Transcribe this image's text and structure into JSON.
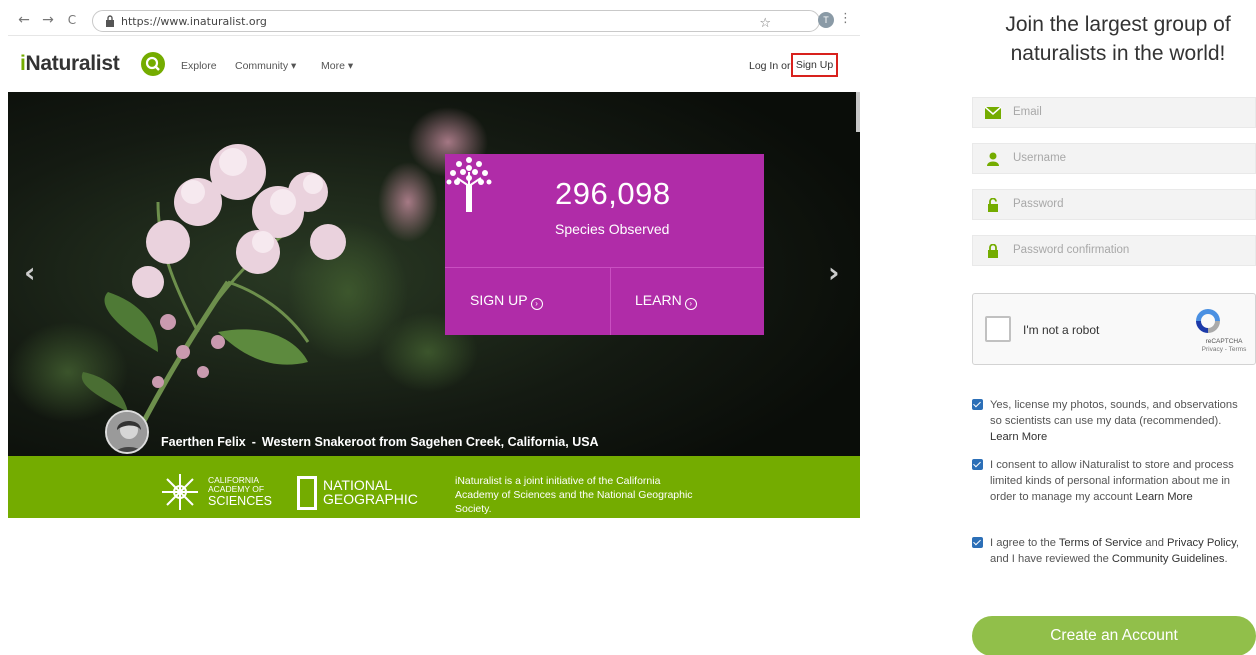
{
  "browser": {
    "url": "https://www.inaturalist.org",
    "back_glyph": "←",
    "forward_glyph": "→",
    "reload_glyph": "C",
    "star_glyph": "☆",
    "profile_initial": "T",
    "menu_glyph": "⋮"
  },
  "site": {
    "logo_i": "i",
    "logo_rest": "Naturalist",
    "nav": {
      "explore": "Explore",
      "community": "Community ▾",
      "more": "More ▾",
      "login": "Log In or",
      "signup": "Sign Up"
    },
    "hero": {
      "stat_number": "296,098",
      "stat_label": "Species Observed",
      "card_signup": "SIGN UP",
      "card_learn": "LEARN",
      "prev": "‹",
      "next": "›",
      "photo_credit_name": "Faerthen Felix",
      "photo_credit_sep": "-",
      "photo_credit_desc": "Western Snakeroot from Sagehen Creek, California, USA"
    },
    "footer": {
      "cas_line1": "CALIFORNIA",
      "cas_line2": "ACADEMY OF",
      "cas_line3": "SCIENCES",
      "natgeo_line1": "NATIONAL",
      "natgeo_line2": "GEOGRAPHIC",
      "initiative": "iNaturalist is a joint initiative of the California Academy of Sciences and the National Geographic Society."
    }
  },
  "form": {
    "title": "Join the largest group of naturalists in the world!",
    "email_placeholder": "Email",
    "username_placeholder": "Username",
    "password_placeholder": "Password",
    "password_confirm_placeholder": "Password confirmation",
    "recaptcha_label": "I'm not a robot",
    "recaptcha_brand": "reCAPTCHA",
    "recaptcha_terms": "Privacy - Terms",
    "consent_license_a": "Yes, license my photos, sounds, and observations so scientists can use my data (recommended).",
    "consent_license_learn": "Learn More",
    "consent_store_a": "I consent to allow iNaturalist to store and process limited kinds of personal information about me in order to manage my account",
    "consent_store_learn": "Learn More",
    "consent_terms_a": "I agree to the",
    "consent_terms_tos": "Terms of Service",
    "consent_terms_and": "and",
    "consent_terms_privacy": "Privacy Policy",
    "consent_terms_b": ", and I have reviewed the",
    "consent_terms_guidelines": "Community Guidelines",
    "consent_terms_end": ".",
    "create_button": "Create an Account"
  },
  "colors": {
    "brand_green": "#74ac00",
    "stat_magenta": "#b02ca8",
    "button_green": "#91bf4a",
    "checkbox_blue": "#2c6fb7",
    "highlight_red": "#d8211d"
  }
}
